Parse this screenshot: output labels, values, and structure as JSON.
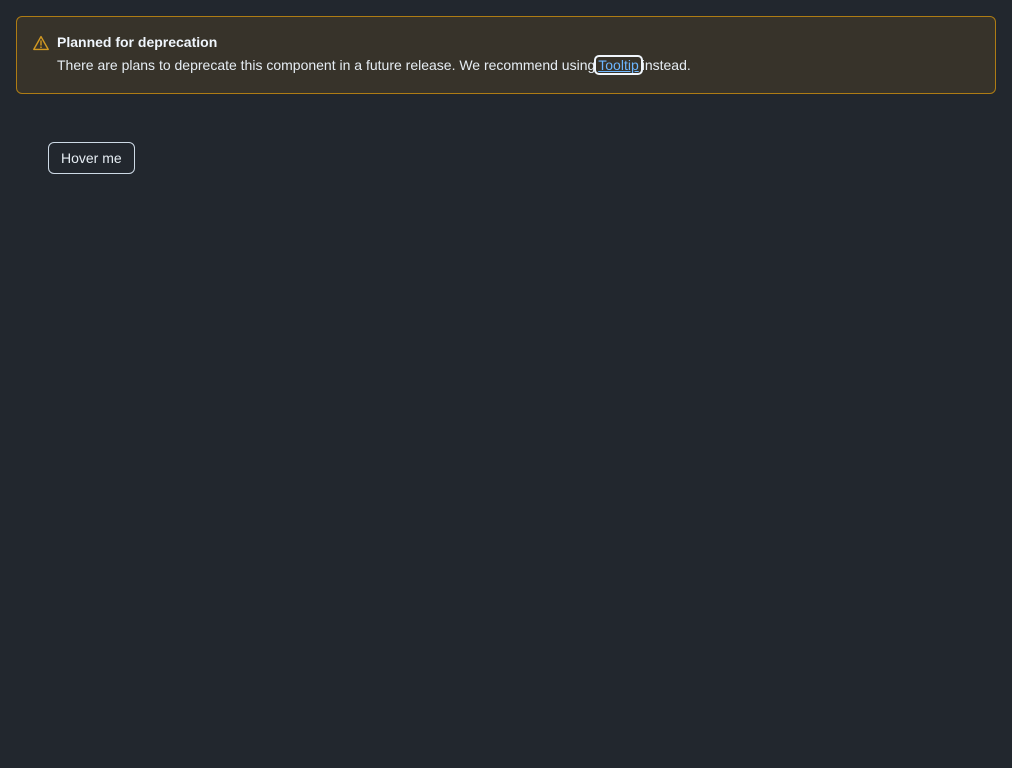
{
  "flash": {
    "title": "Planned for deprecation",
    "text_before": "There are plans to deprecate this component in a future release. We recommend using",
    "link_label": "Tooltip",
    "text_after": "instead.",
    "icon": "alert-triangle-icon",
    "accent_color": "#d29922",
    "border_color": "#ae7c14",
    "background_color": "#37332a"
  },
  "demo": {
    "button_label": "Hover me"
  },
  "colors": {
    "page_background": "#22272e",
    "link": "#6cb6ff"
  }
}
